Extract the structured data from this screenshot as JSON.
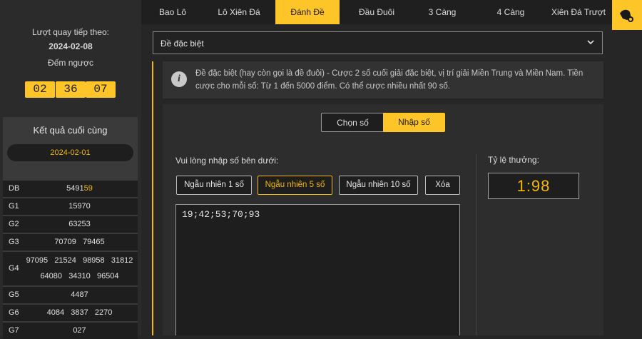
{
  "sidebar": {
    "next_draw_label": "Lượt quay tiếp theo:",
    "next_draw_date": "2024-02-08",
    "countdown_label": "Đếm ngược",
    "countdown": {
      "h": "02",
      "m": "36",
      "s": "07"
    },
    "results_title": "Kết quả cuối cùng",
    "results_date": "2024-02-01",
    "results": [
      {
        "key": "DB",
        "lines": [
          "549159"
        ],
        "highlight_prefix": "5491",
        "highlight_suffix": "59"
      },
      {
        "key": "G1",
        "lines": [
          "15970"
        ]
      },
      {
        "key": "G2",
        "lines": [
          "63253"
        ]
      },
      {
        "key": "G3",
        "lines": [
          "70709   79465"
        ]
      },
      {
        "key": "G4",
        "lines": [
          "97095   21524   98958   31812",
          "64080   34310   96504"
        ]
      },
      {
        "key": "G5",
        "lines": [
          "4487"
        ]
      },
      {
        "key": "G6",
        "lines": [
          "4084   3837   2270"
        ]
      },
      {
        "key": "G7",
        "lines": [
          "027"
        ]
      }
    ]
  },
  "nav": {
    "tabs": [
      "Bao Lô",
      "Lô Xiên Đá",
      "Đánh Đề",
      "Đầu Đuôi",
      "3 Càng",
      "4 Càng",
      "Xiên Đá Trượt"
    ],
    "active_index": 2,
    "icon": "coin-hand-icon"
  },
  "main": {
    "select_value": "Đề đặc biệt",
    "info_text": "Đề đặc biệt (hay còn gọi là đề đuôi) - Cược 2 số cuối giải đặc biệt, vị trí giải Miền Trung và Miền Nam. Tiền cược cho mỗi số: Từ 1 đến 5000 điểm. Có thể cược nhiều nhất 90 số.",
    "mode_tabs": [
      "Chọn số",
      "Nhập số"
    ],
    "mode_active": 1,
    "input_prompt": "Vui lòng nhập số bên dưới:",
    "buttons": [
      "Ngẫu nhiên 1 số",
      "Ngẫu nhiên 5 số",
      "Ngẫu nhiên 10 số",
      "Xóa"
    ],
    "selected_button": 1,
    "numbers_value": "19;42;53;70;93",
    "ratio_label": "Tỷ lệ thưởng:",
    "ratio_value": "1:98"
  },
  "colors": {
    "accent": "#fdc527",
    "background": "#262626"
  }
}
